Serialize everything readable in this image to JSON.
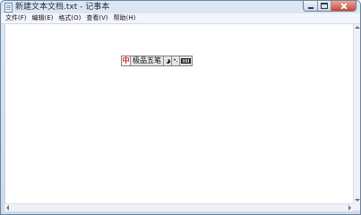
{
  "window": {
    "title": "新建文本文档.txt - 记事本",
    "icon": "notepad-icon"
  },
  "menubar": {
    "items": [
      "文件(F)",
      "编辑(E)",
      "格式(O)",
      "查看(V)",
      "帮助(H)"
    ]
  },
  "ime": {
    "logo_char": "中",
    "name": "极品五笔",
    "moon_icon": "half-width-moon-icon",
    "punct_label": "•,",
    "keyboard_icon": "soft-keyboard-icon"
  },
  "editor": {
    "content": ""
  },
  "colors": {
    "close_button": "#c6493a",
    "ime_logo": "#d12020"
  }
}
